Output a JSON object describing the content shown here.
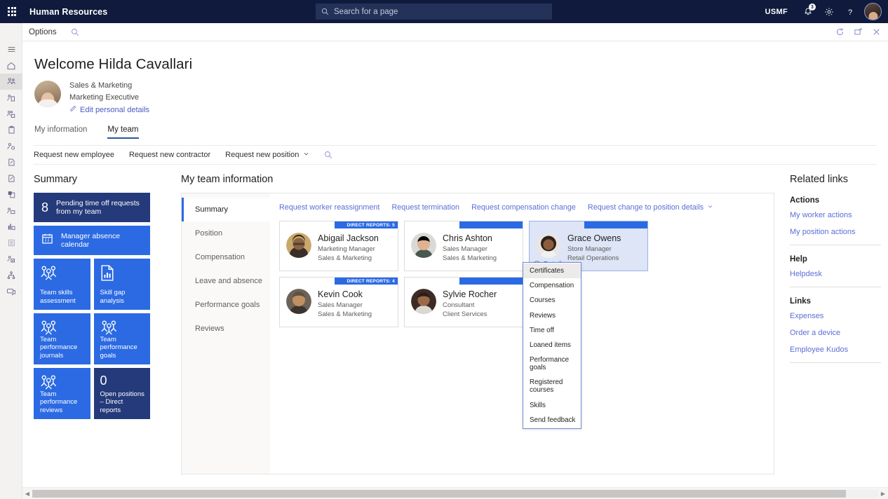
{
  "topnav": {
    "waffle_label": "app-launcher",
    "app_title": "Human Resources",
    "search_placeholder": "Search for a page",
    "search_value": "",
    "company_code": "USMF",
    "notification_badge": "3",
    "icons": [
      "waffle-icon",
      "search-icon",
      "notification-bell-icon",
      "gear-icon",
      "help-question-icon",
      "user-avatar"
    ]
  },
  "commandbar": {
    "hamburger": "hamburger-menu-icon",
    "options_label": "Options",
    "search_icon": "search-icon",
    "refresh_icon": "refresh-icon",
    "popout_icon": "open-in-new-window-icon",
    "close_icon": "close-icon"
  },
  "rail": {
    "items": [
      {
        "name": "hamburger-icon"
      },
      {
        "name": "home-icon"
      },
      {
        "name": "people-icon",
        "active": true
      },
      {
        "name": "person-document-icon"
      },
      {
        "name": "group-settings-icon"
      },
      {
        "name": "clipboard-icon"
      },
      {
        "name": "person-check-icon"
      },
      {
        "name": "document-edit-icon"
      },
      {
        "name": "document-edit-alt-icon"
      },
      {
        "name": "report-icon"
      },
      {
        "name": "person-card-icon"
      },
      {
        "name": "chart-person-icon"
      },
      {
        "name": "list-icon"
      },
      {
        "name": "person-approve-icon"
      },
      {
        "name": "org-chart-icon"
      },
      {
        "name": "feedback-icon"
      }
    ]
  },
  "welcome": {
    "title": "Welcome Hilda Cavallari",
    "department": "Sales & Marketing",
    "job_title": "Marketing Executive",
    "edit_link": "Edit personal details",
    "edit_icon": "pencil-icon"
  },
  "tabs": [
    {
      "label": "My information",
      "active": false
    },
    {
      "label": "My team",
      "active": true
    }
  ],
  "actionbar": {
    "items": [
      {
        "label": "Request new employee",
        "chevron": false
      },
      {
        "label": "Request new contractor",
        "chevron": false
      },
      {
        "label": "Request new position",
        "chevron": true
      }
    ],
    "search_icon": "search-icon"
  },
  "summary": {
    "heading": "Summary",
    "tiles": [
      {
        "kind": "wide",
        "number": "8",
        "label": "Pending time off requests from my team",
        "dark": true,
        "icon": null
      },
      {
        "kind": "wide",
        "number": null,
        "label": "Manager absence calendar",
        "dark": false,
        "icon": "calendar-icon"
      },
      {
        "kind": "sq",
        "number": null,
        "label": "Team skills assessment",
        "dark": false,
        "icon": "people-group-icon"
      },
      {
        "kind": "sq",
        "number": null,
        "label": "Skill gap analysis",
        "dark": false,
        "icon": "document-chart-icon"
      },
      {
        "kind": "sq",
        "number": null,
        "label": "Team performance journals",
        "dark": false,
        "icon": "people-group-icon"
      },
      {
        "kind": "sq",
        "number": null,
        "label": "Team performance goals",
        "dark": false,
        "icon": "people-group-icon"
      },
      {
        "kind": "sq",
        "number": null,
        "label": "Team performance reviews",
        "dark": false,
        "icon": "people-group-icon"
      },
      {
        "kind": "sq",
        "number": "0",
        "label": "Open positions – Direct reports",
        "dark": true,
        "icon": null
      }
    ]
  },
  "team": {
    "heading": "My team information",
    "nav": [
      {
        "label": "Summary",
        "active": true
      },
      {
        "label": "Position",
        "active": false
      },
      {
        "label": "Compensation",
        "active": false
      },
      {
        "label": "Leave and absence",
        "active": false
      },
      {
        "label": "Performance goals",
        "active": false
      },
      {
        "label": "Reviews",
        "active": false
      }
    ],
    "links": [
      {
        "label": "Request worker reassignment",
        "chevron": false
      },
      {
        "label": "Request termination",
        "chevron": false
      },
      {
        "label": "Request compensation change",
        "chevron": false
      },
      {
        "label": "Request change to position details",
        "chevron": true
      }
    ],
    "cards": [
      {
        "name": "Abigail Jackson",
        "title": "Marketing Manager",
        "dept": "Sales & Marketing",
        "badge": "DIRECT REPORTS: 5",
        "selected": false,
        "details": null
      },
      {
        "name": "Chris Ashton",
        "title": "Sales Manager",
        "dept": "Sales & Marketing",
        "badge": "",
        "selected": false,
        "details": null
      },
      {
        "name": "Grace Owens",
        "title": "Store Manager",
        "dept": "Retail Operations",
        "badge": "",
        "selected": true,
        "details": "Details"
      },
      {
        "name": "Kevin Cook",
        "title": "Sales Manager",
        "dept": "Sales & Marketing",
        "badge": "DIRECT REPORTS: 4",
        "selected": false,
        "details": null
      },
      {
        "name": "Sylvie Rocher",
        "title": "Consultant",
        "dept": "Client Services",
        "badge": "",
        "selected": false,
        "details": null
      }
    ],
    "dropdown": {
      "items": [
        {
          "label": "Certificates",
          "highlighted": true
        },
        {
          "label": "Compensation",
          "highlighted": false
        },
        {
          "label": "Courses",
          "highlighted": false
        },
        {
          "label": "Reviews",
          "highlighted": false
        },
        {
          "label": "Time off",
          "highlighted": false
        },
        {
          "label": "Loaned items",
          "highlighted": false
        },
        {
          "label": "Performance goals",
          "highlighted": false
        },
        {
          "label": "Registered courses",
          "highlighted": false
        },
        {
          "label": "Skills",
          "highlighted": false
        },
        {
          "label": "Send feedback",
          "highlighted": false
        }
      ]
    }
  },
  "related": {
    "heading": "Related links",
    "groups": [
      {
        "title": "Actions",
        "links": [
          "My worker actions",
          "My position actions"
        ]
      },
      {
        "title": "Help",
        "links": [
          "Helpdesk"
        ]
      },
      {
        "title": "Links",
        "links": [
          "Expenses",
          "Order a device",
          "Employee Kudos"
        ]
      }
    ]
  },
  "colors": {
    "nav_dark": "#0f1a3c",
    "tile_blue": "#2b6ae3",
    "tile_dark_blue": "#243a7a",
    "link_blue": "#5b6fd6",
    "accent_underline": "#2b579a",
    "card_selected": "#dde5f7"
  }
}
